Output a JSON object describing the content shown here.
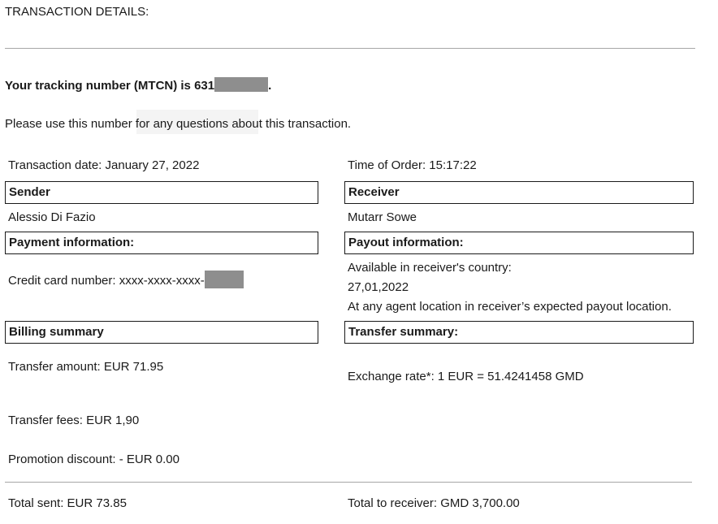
{
  "heading": "TRANSACTION DETAILS:",
  "tracking": {
    "prefix": "Your tracking number (MTCN) is 631",
    "suffix": "."
  },
  "note": "Please use this number for any questions about this transaction.",
  "transaction_date": "Transaction date: January 27, 2022",
  "time_of_order": "Time of Order: 15:17:22",
  "sender": {
    "header": "Sender",
    "name": "Alessio Di Fazio"
  },
  "receiver": {
    "header": "Receiver",
    "name": "Mutarr Sowe"
  },
  "payment": {
    "header": "Payment information:",
    "card_prefix": "Credit card number: xxxx-xxxx-xxxx-"
  },
  "payout": {
    "header": "Payout information:",
    "line1": "Available in receiver's country:",
    "date": "27,01,2022",
    "line3": "At any agent location in receiver’s expected payout location."
  },
  "billing": {
    "header": "Billing summary",
    "amount": "Transfer amount: EUR 71.95",
    "fees": "Transfer fees: EUR 1,90",
    "discount": "Promotion discount: - EUR 0.00"
  },
  "transfer": {
    "header": "Transfer summary:",
    "rate": "Exchange rate*: 1 EUR = 51.4241458 GMD"
  },
  "totals": {
    "sent": "Total sent: EUR 73.85",
    "received": "Total to receiver: GMD 3,700.00"
  },
  "colors": {
    "redaction": "#8e8e8e",
    "rule": "#a6a6a6"
  }
}
